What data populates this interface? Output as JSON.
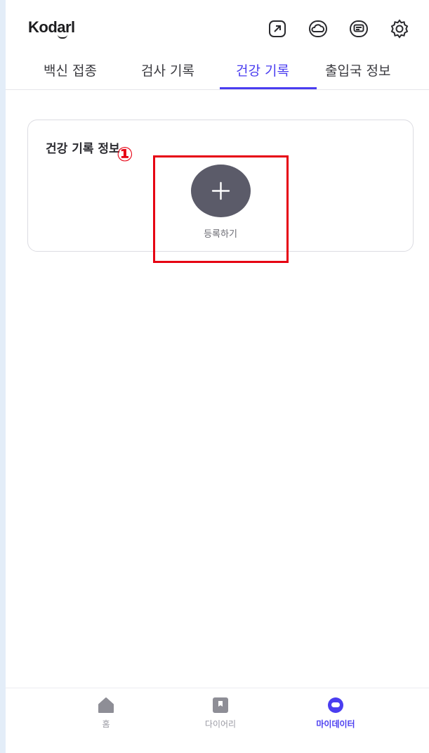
{
  "header": {
    "logo": "Kodarl",
    "icons": [
      "external-link-icon",
      "cloud-icon",
      "message-icon",
      "gear-icon"
    ]
  },
  "tabs": [
    {
      "label": "백신 접종",
      "active": false
    },
    {
      "label": "검사 기록",
      "active": false
    },
    {
      "label": "건강 기록",
      "active": true
    },
    {
      "label": "출입국 정보",
      "active": false
    }
  ],
  "card": {
    "title": "건강 기록 정보",
    "add_label": "등록하기"
  },
  "annotation": {
    "marker": "①",
    "color": "#e60012"
  },
  "bottom_nav": [
    {
      "label": "홈",
      "icon": "home-icon",
      "active": false
    },
    {
      "label": "다이어리",
      "icon": "bookmark-icon",
      "active": false
    },
    {
      "label": "마이데이터",
      "icon": "mydata-icon",
      "active": true
    }
  ],
  "colors": {
    "accent": "#4a3df0",
    "add_button": "#5b5b69"
  }
}
